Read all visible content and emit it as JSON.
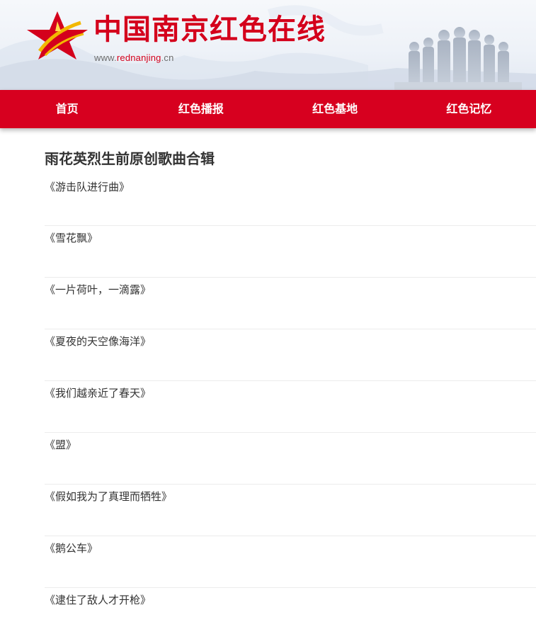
{
  "header": {
    "title": "中国南京红色在线",
    "url_prefix": "www.",
    "url_accent": "rednanjing",
    "url_suffix": ".cn",
    "brand_color": "#d7001f",
    "logo_icon": "red-star-icon"
  },
  "nav": {
    "items": [
      {
        "label": "首页"
      },
      {
        "label": "红色播报"
      },
      {
        "label": "红色基地"
      },
      {
        "label": "红色记忆"
      }
    ]
  },
  "main": {
    "title": "雨花英烈生前原创歌曲合辑",
    "songs": [
      {
        "label": "《游击队进行曲》"
      },
      {
        "label": "《雪花飘》"
      },
      {
        "label": "《一片荷叶，一滴露》"
      },
      {
        "label": "《夏夜的天空像海洋》"
      },
      {
        "label": "《我们越亲近了春天》"
      },
      {
        "label": "《盟》"
      },
      {
        "label": "《假如我为了真理而牺牲》"
      },
      {
        "label": "《鹅公车》"
      },
      {
        "label": "《逮住了敌人才开枪》"
      }
    ]
  }
}
